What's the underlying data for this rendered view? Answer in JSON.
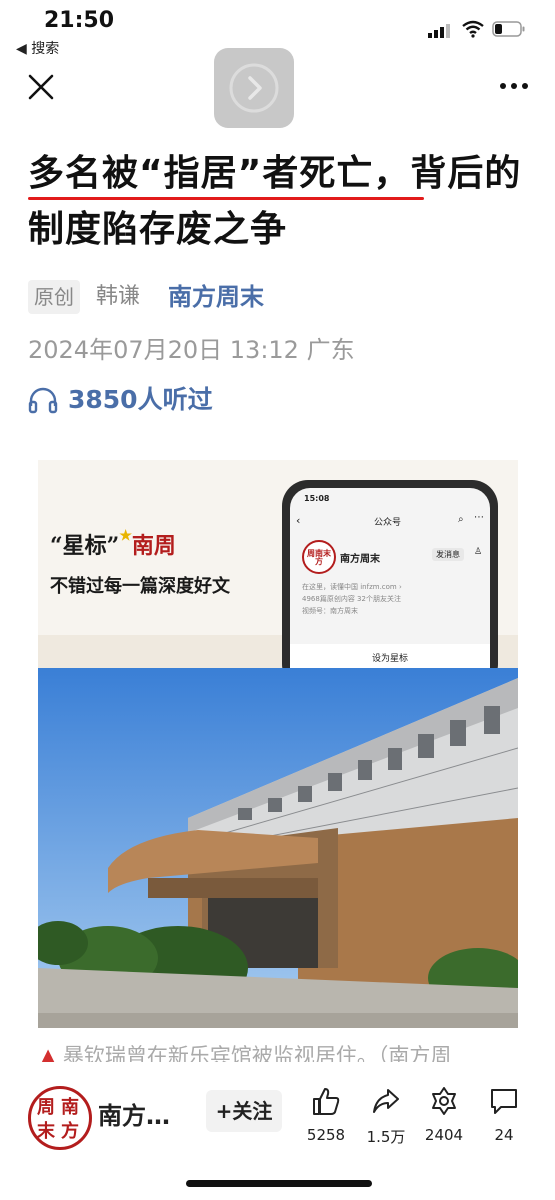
{
  "status": {
    "time": "21:50",
    "back_label": "◀ 搜索"
  },
  "article": {
    "title": "多名被“指居”者死亡，背后的制度陷存废之争",
    "original_tag": "原创",
    "author": "韩谦",
    "account": "南方周末",
    "date": "2024年07月20日 13:12 广东",
    "listens": "3850人听过"
  },
  "banner": {
    "star_prefix": "“星标”",
    "star_suffix": "南周",
    "subtitle": "不错过每一篇深度好文",
    "phone": {
      "time": "15:08",
      "header": "公众号",
      "account": "南方周末",
      "message_button": "发消息",
      "line1": "在这里，读懂中国   infzm.com  ›",
      "line2": "4968篇原创内容   32个朋友关注",
      "line3": "视频号：南方周末",
      "star_button": "设为星标",
      "logo_chars": "周南末方"
    }
  },
  "caption": {
    "marker": "▲",
    "text": "暴钦瑞曾在新乐宾馆被监视居住。（南方周"
  },
  "bottom_bar": {
    "logo_chars": [
      "周",
      "南",
      "末",
      "方"
    ],
    "account_name": "南方…",
    "follow_label": "+关注",
    "actions": [
      {
        "icon": "thumbs-up-icon",
        "count": "5258"
      },
      {
        "icon": "share-icon",
        "count": "1.5万"
      },
      {
        "icon": "recommend-icon",
        "count": "2404"
      },
      {
        "icon": "comment-icon",
        "count": "24"
      }
    ]
  },
  "colors": {
    "accent_blue": "#4a6ea8",
    "brand_red": "#b31d1d",
    "underline_red": "#e21b1b"
  }
}
